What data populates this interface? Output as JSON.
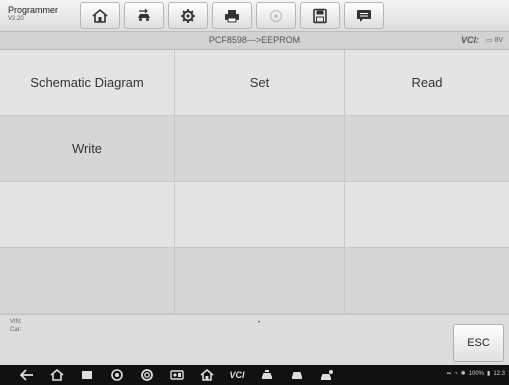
{
  "header": {
    "app_title": "Programmer",
    "version": "V2.20",
    "toolbar": [
      {
        "icon": "home-icon",
        "enabled": true
      },
      {
        "icon": "vehicle-swap-icon",
        "enabled": true
      },
      {
        "icon": "settings-gear-icon",
        "enabled": true
      },
      {
        "icon": "printer-icon",
        "enabled": true
      },
      {
        "icon": "help-icon",
        "enabled": false
      },
      {
        "icon": "save-icon",
        "enabled": true
      },
      {
        "icon": "message-icon",
        "enabled": true
      }
    ]
  },
  "subheader": {
    "path": "PCF8598--->EEPROM",
    "vci_label": "VCI:",
    "battery": "8V"
  },
  "functions": {
    "schematic": "Schematic Diagram",
    "set": "Set",
    "read": "Read",
    "write": "Write"
  },
  "info": {
    "vin_label": "VIN:",
    "car_label": "Car:",
    "dot": "•",
    "esc_label": "ESC"
  },
  "navbar": {
    "vci_label": "VCI",
    "battery_percent": "100%",
    "time": "12:3"
  },
  "colors": {
    "row_light": "#e4e4e4",
    "row_dark": "#d6d6d6",
    "toolbar_bg": "#dcdcdc",
    "navbar_bg": "#111111"
  }
}
